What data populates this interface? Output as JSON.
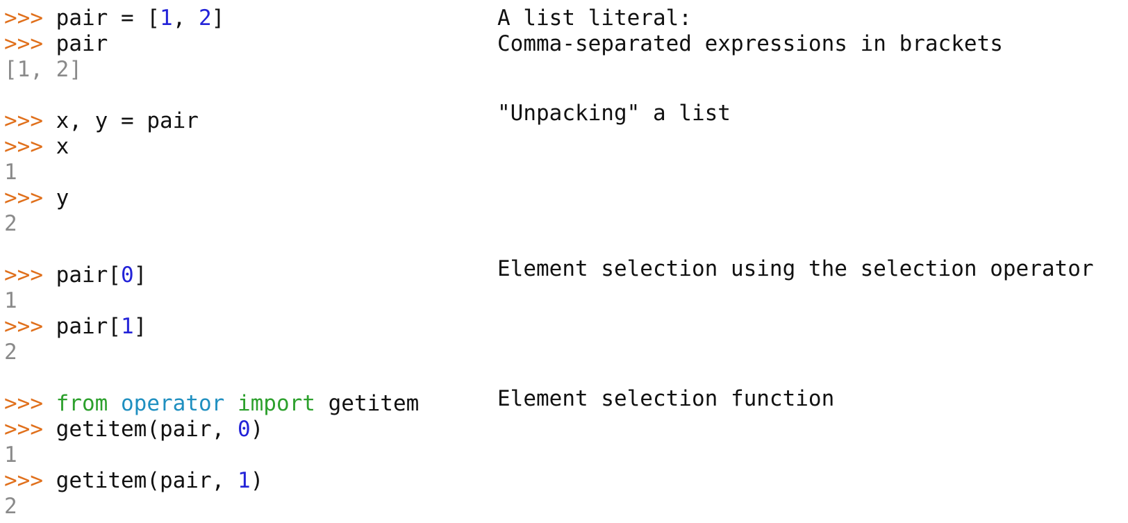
{
  "colors": {
    "prompt": "#e0701c",
    "number": "#2323d8",
    "keyword": "#2ca02c",
    "module": "#1f8fc0",
    "output": "#8a8a8a",
    "text": "#111111"
  },
  "prompt": ">>>",
  "lines": [
    {
      "kind": "input",
      "tokens": [
        {
          "t": "pair = [",
          "c": "text"
        },
        {
          "t": "1",
          "c": "number"
        },
        {
          "t": ", ",
          "c": "text"
        },
        {
          "t": "2",
          "c": "number"
        },
        {
          "t": "]",
          "c": "text"
        }
      ]
    },
    {
      "kind": "input",
      "tokens": [
        {
          "t": "pair",
          "c": "text"
        }
      ]
    },
    {
      "kind": "output",
      "text": "[1, 2]"
    },
    {
      "kind": "input",
      "tokens": [
        {
          "t": "x, y = pair",
          "c": "text"
        }
      ]
    },
    {
      "kind": "input",
      "tokens": [
        {
          "t": "x",
          "c": "text"
        }
      ]
    },
    {
      "kind": "output",
      "text": "1"
    },
    {
      "kind": "input",
      "tokens": [
        {
          "t": "y",
          "c": "text"
        }
      ]
    },
    {
      "kind": "output",
      "text": "2"
    },
    {
      "kind": "input",
      "tokens": [
        {
          "t": "pair[",
          "c": "text"
        },
        {
          "t": "0",
          "c": "number"
        },
        {
          "t": "]",
          "c": "text"
        }
      ]
    },
    {
      "kind": "output",
      "text": "1"
    },
    {
      "kind": "input",
      "tokens": [
        {
          "t": "pair[",
          "c": "text"
        },
        {
          "t": "1",
          "c": "number"
        },
        {
          "t": "]",
          "c": "text"
        }
      ]
    },
    {
      "kind": "output",
      "text": "2"
    },
    {
      "kind": "input",
      "tokens": [
        {
          "t": "from",
          "c": "keyword"
        },
        {
          "t": " ",
          "c": "text"
        },
        {
          "t": "operator",
          "c": "module"
        },
        {
          "t": " ",
          "c": "text"
        },
        {
          "t": "import",
          "c": "keyword"
        },
        {
          "t": " getitem",
          "c": "text"
        }
      ]
    },
    {
      "kind": "input",
      "tokens": [
        {
          "t": "getitem(pair, ",
          "c": "text"
        },
        {
          "t": "0",
          "c": "number"
        },
        {
          "t": ")",
          "c": "text"
        }
      ]
    },
    {
      "kind": "output",
      "text": "1"
    },
    {
      "kind": "input",
      "tokens": [
        {
          "t": "getitem(pair, ",
          "c": "text"
        },
        {
          "t": "1",
          "c": "number"
        },
        {
          "t": ")",
          "c": "text"
        }
      ]
    },
    {
      "kind": "output",
      "text": "2"
    }
  ],
  "annotations": [
    {
      "text": "A list literal:"
    },
    {
      "text": "Comma-separated expressions in brackets"
    },
    {
      "text": "\"Unpacking\" a list"
    },
    {
      "text": "Element selection using the selection operator"
    },
    {
      "text": "Element selection function"
    }
  ]
}
